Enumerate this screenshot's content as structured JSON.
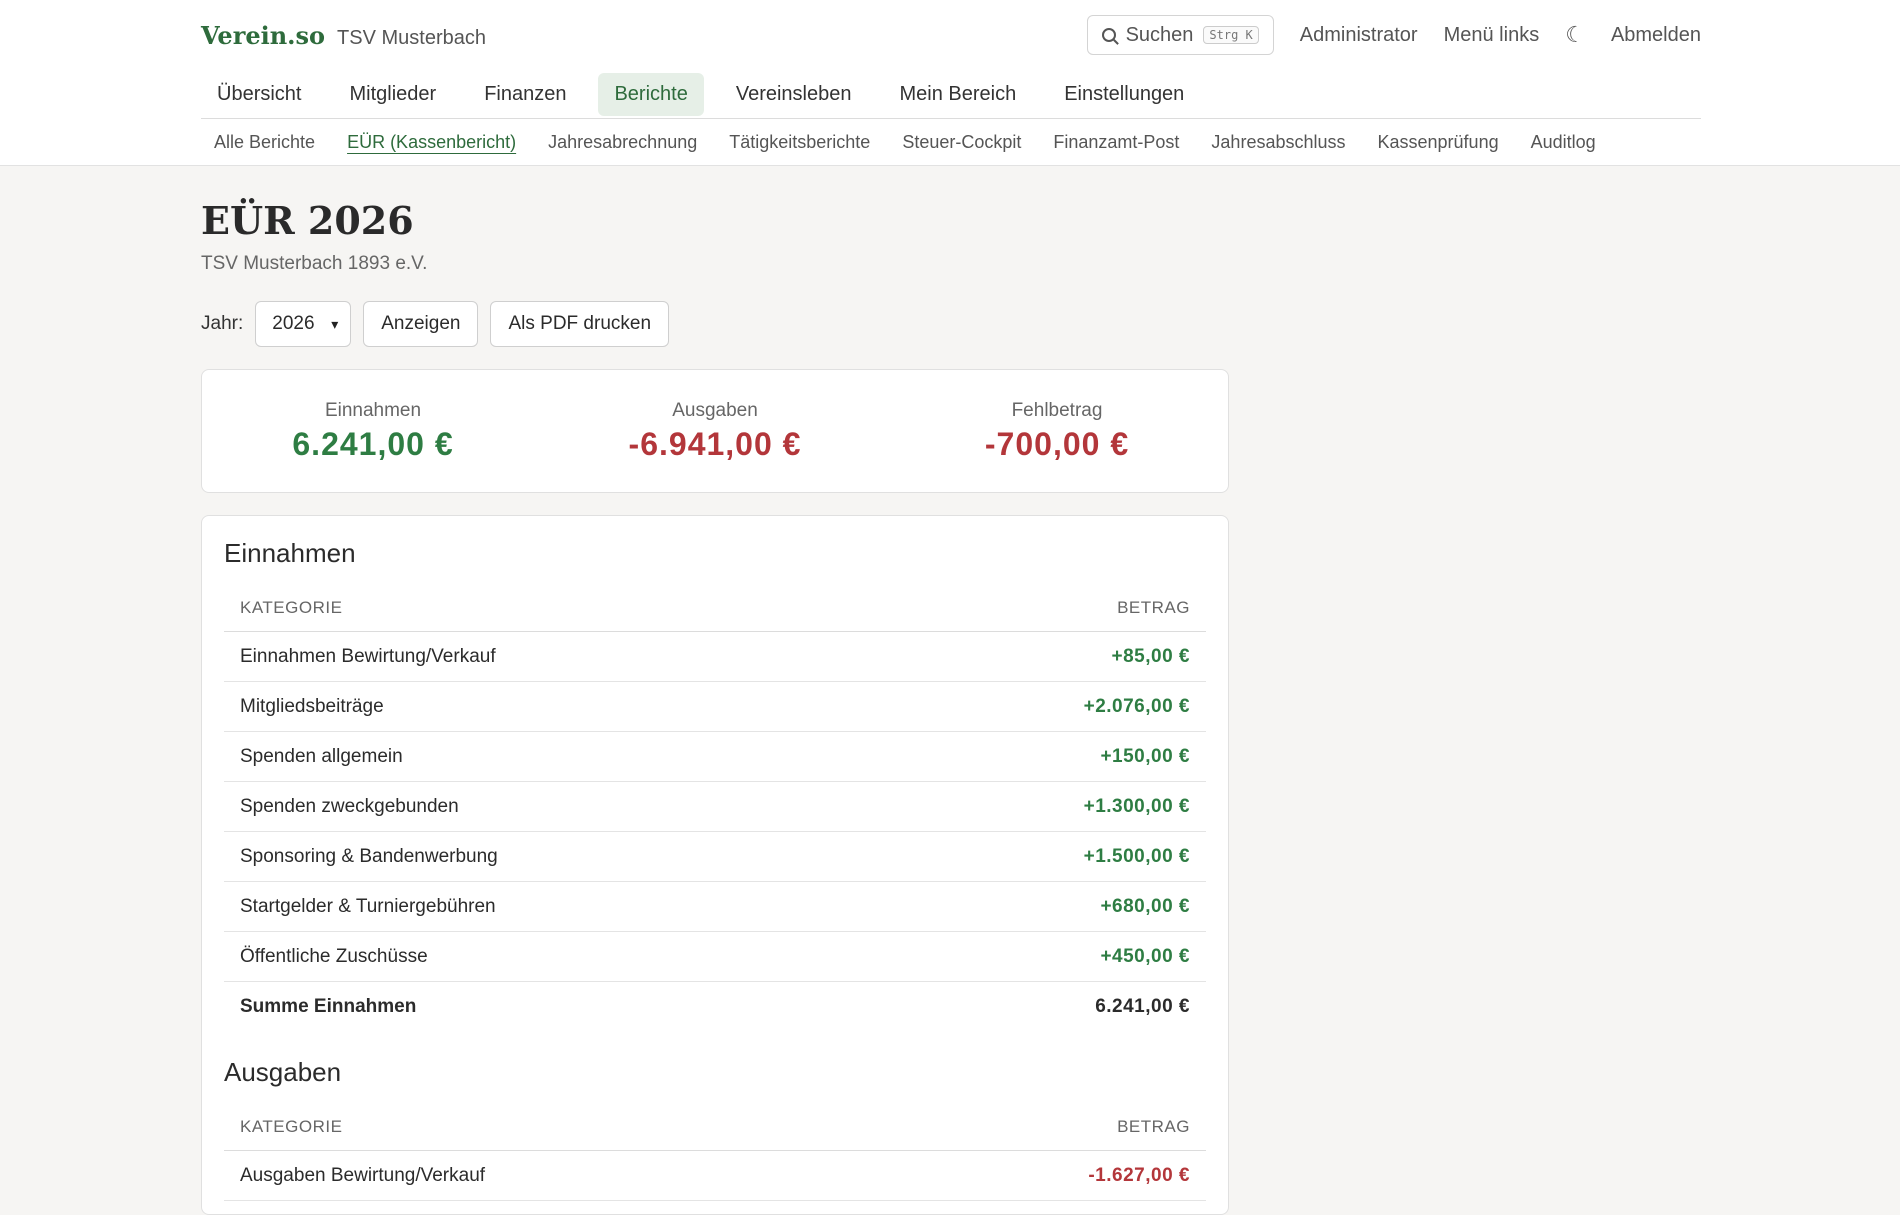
{
  "header": {
    "logo": "Verein.so",
    "club": "TSV Musterbach",
    "search_label": "Suchen",
    "shortcut": "Strg K",
    "admin": "Administrator",
    "menu": "Menü links",
    "logout": "Abmelden"
  },
  "nav": [
    "Übersicht",
    "Mitglieder",
    "Finanzen",
    "Berichte",
    "Vereinsleben",
    "Mein Bereich",
    "Einstellungen"
  ],
  "nav_active": "Berichte",
  "subnav": [
    "Alle Berichte",
    "EÜR (Kassenbericht)",
    "Jahresabrechnung",
    "Tätigkeitsberichte",
    "Steuer-Cockpit",
    "Finanzamt-Post",
    "Jahresabschluss",
    "Kassenprüfung",
    "Auditlog"
  ],
  "subnav_active": "EÜR (Kassenbericht)",
  "page": {
    "title": "EÜR 2026",
    "subtitle": "TSV Musterbach 1893 e.V.",
    "year_label": "Jahr:",
    "year_value": "2026",
    "show_button": "Anzeigen",
    "pdf_button": "Als PDF drucken"
  },
  "summary": {
    "income_label": "Einnahmen",
    "income_value": "6.241,00 €",
    "expenses_label": "Ausgaben",
    "expenses_value": "-6.941,00 €",
    "result_label": "Fehlbetrag",
    "result_value": "-700,00 €"
  },
  "income": {
    "title": "Einnahmen",
    "col_category": "KATEGORIE",
    "col_amount": "BETRAG",
    "rows": [
      {
        "category": "Einnahmen Bewirtung/Verkauf",
        "amount": "+85,00 €"
      },
      {
        "category": "Mitgliedsbeiträge",
        "amount": "+2.076,00 €"
      },
      {
        "category": "Spenden allgemein",
        "amount": "+150,00 €"
      },
      {
        "category": "Spenden zweckgebunden",
        "amount": "+1.300,00 €"
      },
      {
        "category": "Sponsoring & Bandenwerbung",
        "amount": "+1.500,00 €"
      },
      {
        "category": "Startgelder & Turniergebühren",
        "amount": "+680,00 €"
      },
      {
        "category": "Öffentliche Zuschüsse",
        "amount": "+450,00 €"
      }
    ],
    "total_label": "Summe Einnahmen",
    "total_value": "6.241,00 €"
  },
  "expenses": {
    "title": "Ausgaben",
    "col_category": "KATEGORIE",
    "col_amount": "BETRAG",
    "rows": [
      {
        "category": "Ausgaben Bewirtung/Verkauf",
        "amount": "-1.627,00 €"
      }
    ]
  },
  "colors": {
    "accent": "#2e6b3c",
    "positive": "#2e7d43",
    "negative": "#b3363a"
  }
}
